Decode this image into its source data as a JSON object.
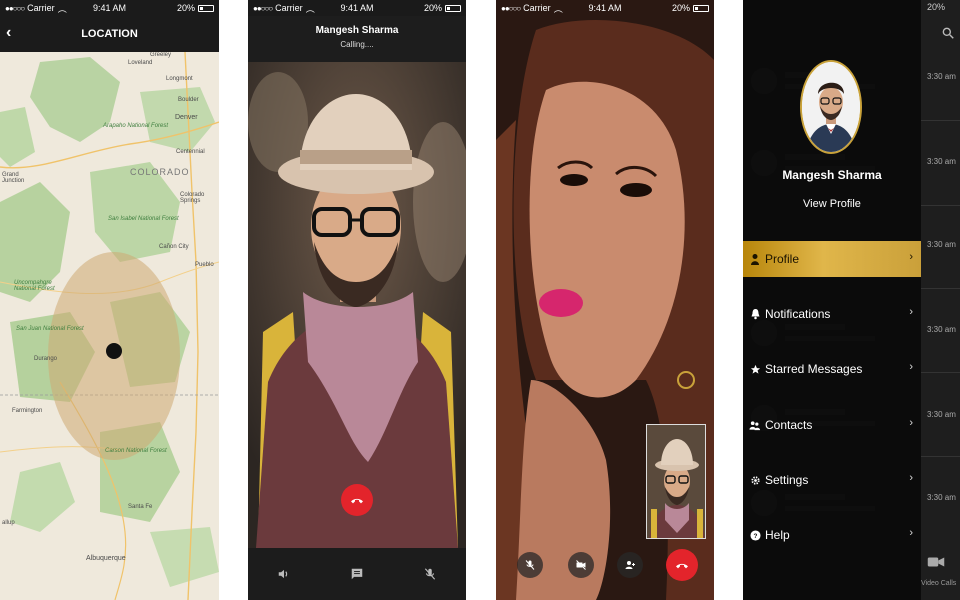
{
  "colors": {
    "accent_gold": "#d4a93c",
    "end_call_red": "#e3242b",
    "dark_bg": "#141414"
  },
  "status_bar": {
    "carrier": "Carrier",
    "time": "9:41 AM",
    "battery": "20%"
  },
  "location_screen": {
    "title": "LOCATION",
    "back_icon": "chevron-left-icon",
    "map_labels": {
      "loveland": "Loveland",
      "greeley": "Greeley",
      "longmont": "Longmont",
      "boulder": "Boulder",
      "denver": "Denver",
      "arapaho": "Arapaho National Forest",
      "centennial": "Centennial",
      "colorado": "COLORADO",
      "grand_junction": "Grand\nJunction",
      "colorado_springs": "Colorado\nSprings",
      "san_isabel": "San Isabel National Forest",
      "canon_city": "Cañon City",
      "pueblo": "Pueblo",
      "uncompahgre": "Uncompahgre\nNational Forest",
      "san_juan": "San Juan National Forest",
      "durango": "Durango",
      "farmington": "Farmington",
      "carson": "Carson National Forest",
      "santa_fe": "Santa Fe",
      "albuquerque": "Albuquerque",
      "allup": "allup"
    }
  },
  "calling_screen": {
    "name": "Mangesh Sharma",
    "status": "Calling....",
    "bottom_icons": [
      "speaker-icon",
      "message-icon",
      "mute-microphone-icon"
    ]
  },
  "video_screen": {
    "controls": [
      "mute-microphone-icon",
      "video-off-icon",
      "add-user-icon",
      "end-call-icon"
    ]
  },
  "menu_screen": {
    "profile_name": "Mangesh Sharma",
    "view_profile": "View Profile",
    "items": [
      {
        "label": "Profile",
        "icon": "person-icon",
        "active": true
      },
      {
        "label": "Notifications",
        "icon": "bell-icon",
        "active": false
      },
      {
        "label": "Starred Messages",
        "icon": "star-icon",
        "active": false
      },
      {
        "label": "Contacts",
        "icon": "contacts-icon",
        "active": false
      },
      {
        "label": "Settings",
        "icon": "gear-icon",
        "active": false
      },
      {
        "label": "Help",
        "icon": "help-icon",
        "active": false
      }
    ],
    "side_times": [
      "3:30 am",
      "3:30 am",
      "3:30 am",
      "3:30 am",
      "3:30 am",
      "3:30 am"
    ],
    "side_bottom_label": "Video Calls"
  }
}
